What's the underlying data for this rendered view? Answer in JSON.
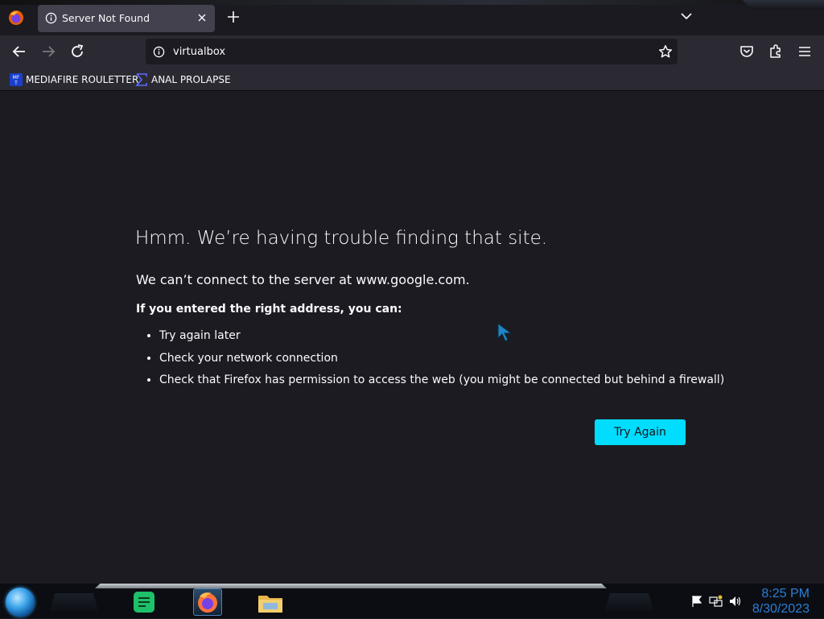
{
  "browser": {
    "tab": {
      "title": "Server Not Found"
    },
    "url": "virtualbox",
    "bookmarks": [
      {
        "label": "MEDIAFIRE ROULETTER",
        "icon": "mediafire-icon"
      },
      {
        "label": "ANAL PROLAPSE",
        "icon": "sigma-icon"
      }
    ]
  },
  "error_page": {
    "title": "Hmm. We’re having trouble finding that site.",
    "description": "We can’t connect to the server at www.google.com.",
    "subtitle": "If you entered the right address, you can:",
    "suggestions": [
      "Try again later",
      "Check your network connection",
      "Check that Firefox has permission to access the web (you might be connected but behind a firewall)"
    ],
    "button_label": "Try Again"
  },
  "taskbar": {
    "clock": {
      "time": "8:25 PM",
      "date": "8/30/2023"
    }
  },
  "colors": {
    "accent": "#00ddff",
    "page_bg": "#1c1b22",
    "toolbar_bg": "#2b2a33",
    "clock": "#2b7fd8"
  }
}
